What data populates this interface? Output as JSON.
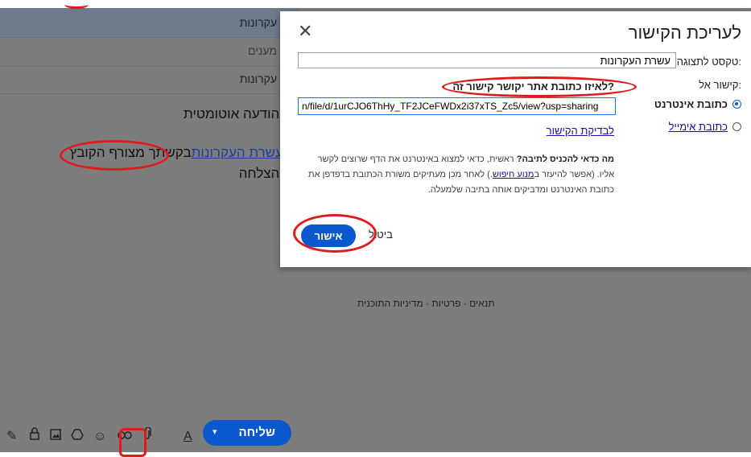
{
  "compose": {
    "subject_top": "עקרונות",
    "recipients": "מענים",
    "subject": "עקרונות",
    "body_line1": "הודעה אוטומטית.",
    "body_line2_prefix": "בקשתך מצורף הקובץ",
    "body_link": "עשרת העקרונות",
    "body_line3": "הצלחה!",
    "send_label": "שליחה",
    "send_caret": "▾"
  },
  "toolbar_icons": [
    "pen-icon",
    "lock-icon",
    "image-icon",
    "drive-icon",
    "emoji-icon",
    "link-icon",
    "attach-icon",
    "format-text-icon"
  ],
  "footer": {
    "links": "תנאים · פרטיות · מדיניות התוכנית"
  },
  "dialog": {
    "title": "לעריכת הקישור",
    "close": "✕",
    "display_label": "טקסט לתצוגה:",
    "display_value": "עשרת העקרונות",
    "link_to_label": "קישור אל:",
    "option_web": "כתובת אינטרנט",
    "option_email": "כתובת אימייל",
    "question": "לאיזו כתובת אתר יקושר קישור זה?",
    "url_value": "n/file/d/1urCJO6ThHy_TF2JCeFWDx2i37xTS_Zc5/view?usp=sharing",
    "test_link": "לבדיקת הקישור",
    "help_bold": "מה כדאי להכניס לתיבה?",
    "help_1": " ראשית, כדאי למצוא באינטרנט את הדף שרוצים לקשר אליו. (אפשר להיעזר ב",
    "help_link": "מנוע חיפוש",
    "help_2": ".) לאחר מכן מעתיקים משורת הכתובת בדפדפן את כתובת האינטרנט ומדביקים אותה בתיבה שלמעלה.",
    "ok": "אישור",
    "cancel": "ביטול"
  },
  "colors": {
    "accent": "#0b57d0",
    "annotation": "#e01b1b",
    "overlay": "#7d7d7d"
  }
}
